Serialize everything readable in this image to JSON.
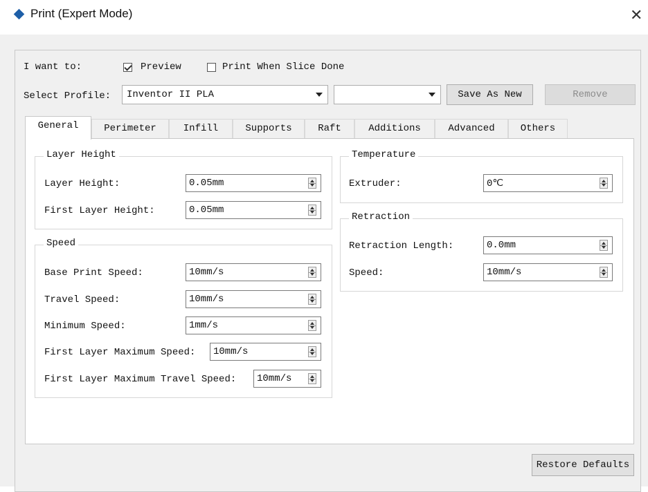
{
  "window": {
    "title": "Print (Expert Mode)"
  },
  "top": {
    "want_label": "I want to:",
    "preview_label": "Preview",
    "preview_checked": true,
    "print_when_done_label": "Print When Slice Done",
    "print_when_done_checked": false,
    "profile_label": "Select Profile:",
    "profile_value": "Inventor II PLA",
    "secondary_value": "",
    "save_as_new_label": "Save As New",
    "remove_label": "Remove"
  },
  "tabs": [
    {
      "label": "General",
      "active": true
    },
    {
      "label": "Perimeter"
    },
    {
      "label": "Infill"
    },
    {
      "label": "Supports"
    },
    {
      "label": "Raft"
    },
    {
      "label": "Additions"
    },
    {
      "label": "Advanced"
    },
    {
      "label": "Others"
    }
  ],
  "groups": {
    "layer": {
      "title": "Layer Height",
      "fields": [
        {
          "label": "Layer Height:",
          "value": "0.05mm"
        },
        {
          "label": "First Layer Height:",
          "value": "0.05mm"
        }
      ]
    },
    "speed": {
      "title": "Speed",
      "fields": [
        {
          "label": "Base Print Speed:",
          "value": "10mm/s"
        },
        {
          "label": "Travel Speed:",
          "value": "10mm/s"
        },
        {
          "label": "Minimum Speed:",
          "value": "1mm/s"
        },
        {
          "label": "First Layer Maximum Speed:",
          "value": "10mm/s"
        },
        {
          "label": "First Layer Maximum Travel Speed:",
          "value": "10mm/s"
        }
      ]
    },
    "temperature": {
      "title": "Temperature",
      "fields": [
        {
          "label": "Extruder:",
          "value": "0℃"
        }
      ]
    },
    "retraction": {
      "title": "Retraction",
      "fields": [
        {
          "label": "Retraction Length:",
          "value": "0.0mm"
        },
        {
          "label": "Speed:",
          "value": "10mm/s"
        }
      ]
    }
  },
  "footer": {
    "restore_label": "Restore Defaults"
  },
  "icons": {
    "app": "diamond-icon",
    "close": "close-icon",
    "dropdown": "chevron-down-icon",
    "spin": "spinner-icon"
  },
  "colors": {
    "app_icon": "#1e5fa8",
    "dialog_bg": "#f0f0f0",
    "panel_bg": "#ffffff"
  }
}
